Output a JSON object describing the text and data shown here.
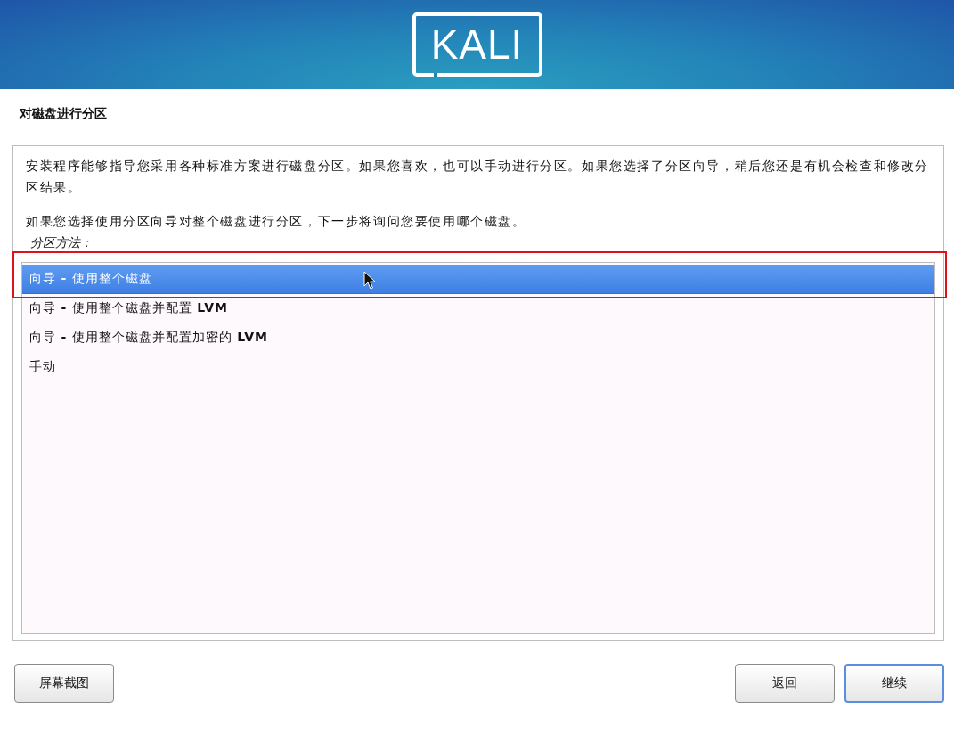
{
  "header": {
    "logo": "KALI"
  },
  "title": "对磁盘进行分区",
  "description": [
    "安装程序能够指导您采用各种标准方案进行磁盘分区。如果您喜欢，也可以手动进行分区。如果您选择了分区向导，稍后您还是有机会检查和修改分区结果。",
    "如果您选择使用分区向导对整个磁盘进行分区，下一步将询问您要使用哪个磁盘。"
  ],
  "options_label": "分区方法：",
  "options": [
    {
      "label": "向导 **-** 使用整个磁盘",
      "selected": true
    },
    {
      "label": "向导 **-** 使用整个磁盘并配置 **LVM**",
      "selected": false
    },
    {
      "label": "向导 **-** 使用整个磁盘并配置加密的 **LVM**",
      "selected": false
    },
    {
      "label": "手动",
      "selected": false
    }
  ],
  "buttons": [
    {
      "label": "屏幕截图",
      "kind": "left",
      "focused": false
    },
    {
      "label": "返回",
      "kind": "right",
      "focused": false
    },
    {
      "label": "继续",
      "kind": "right",
      "focused": true
    }
  ]
}
